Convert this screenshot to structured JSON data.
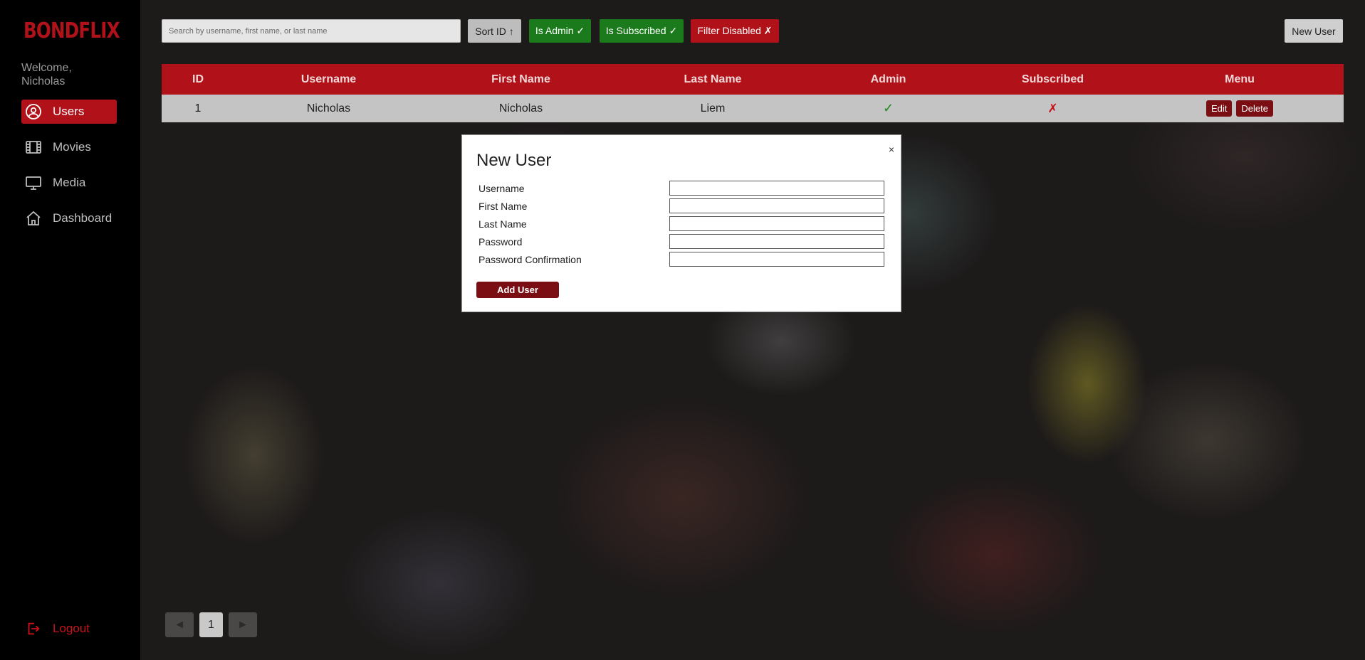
{
  "app": {
    "logo": "BONDFLIX",
    "welcome": "Welcome, Nicholas"
  },
  "sidebar": {
    "items": [
      {
        "label": "Users",
        "icon": "user-circle-icon",
        "active": true
      },
      {
        "label": "Movies",
        "icon": "film-icon"
      },
      {
        "label": "Media",
        "icon": "monitor-icon"
      },
      {
        "label": "Dashboard",
        "icon": "home-icon"
      }
    ],
    "logout": "Logout"
  },
  "toolbar": {
    "search_placeholder": "Search by username, first name, or last name",
    "sort": "Sort ID ↑",
    "is_admin": "Is Admin ✓",
    "is_subscribed": "Is Subscribed ✓",
    "filter": "Filter Disabled ✗",
    "new_user": "New User"
  },
  "table": {
    "headers": [
      "ID",
      "Username",
      "First Name",
      "Last Name",
      "Admin",
      "Subscribed",
      "Menu"
    ],
    "rows": [
      {
        "id": "1",
        "username": "Nicholas",
        "first": "Nicholas",
        "last": "Liem",
        "admin": "✓",
        "subscribed": "✗",
        "edit": "Edit",
        "delete": "Delete"
      }
    ]
  },
  "pagination": {
    "prev": "◄",
    "page": "1",
    "next": "►"
  },
  "modal": {
    "title": "New User",
    "close": "×",
    "fields": [
      "Username",
      "First Name",
      "Last Name",
      "Password",
      "Password Confirmation"
    ],
    "submit": "Add User"
  },
  "colors": {
    "brand": "#b1121a",
    "dark_red": "#7b0e13",
    "green": "#1a7a1c"
  }
}
